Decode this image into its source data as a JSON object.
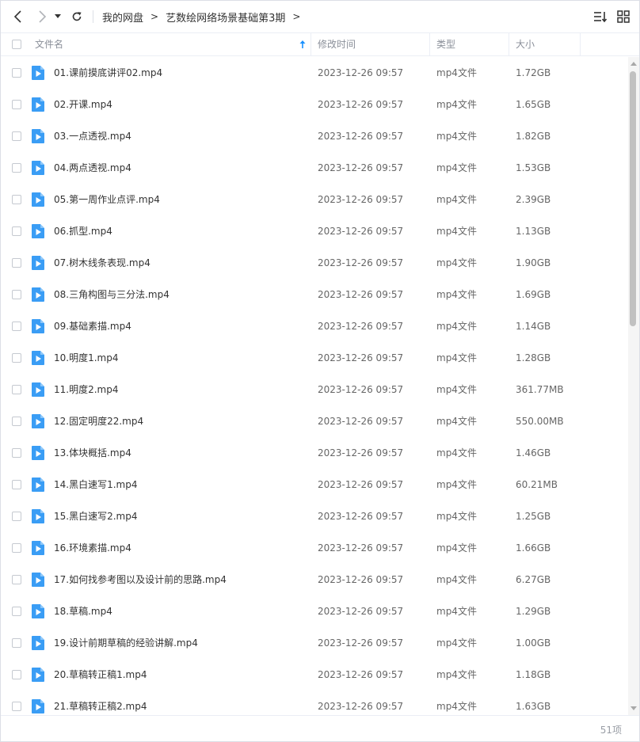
{
  "toolbar": {
    "back_icon": "chevron-left-icon",
    "forward_icon": "chevron-right-icon",
    "history_icon": "caret-down-icon",
    "refresh_icon": "refresh-icon",
    "breadcrumb": [
      {
        "label": "我的网盘"
      },
      {
        "label": "艺数绘网络场景基础第3期"
      }
    ],
    "breadcrumb_sep": ">",
    "sort_icon": "sort-list-icon",
    "view_icon": "grid-view-icon"
  },
  "table": {
    "columns": {
      "name": "文件名",
      "modified": "修改时间",
      "type": "类型",
      "size": "大小"
    },
    "sort_indicator": "arrow-up-icon",
    "rows": [
      {
        "name": "01.课前摸底讲评02.mp4",
        "modified": "2023-12-26 09:57",
        "type": "mp4文件",
        "size": "1.72GB"
      },
      {
        "name": "02.开课.mp4",
        "modified": "2023-12-26 09:57",
        "type": "mp4文件",
        "size": "1.65GB"
      },
      {
        "name": "03.一点透视.mp4",
        "modified": "2023-12-26 09:57",
        "type": "mp4文件",
        "size": "1.82GB"
      },
      {
        "name": "04.两点透视.mp4",
        "modified": "2023-12-26 09:57",
        "type": "mp4文件",
        "size": "1.53GB"
      },
      {
        "name": "05.第一周作业点评.mp4",
        "modified": "2023-12-26 09:57",
        "type": "mp4文件",
        "size": "2.39GB"
      },
      {
        "name": "06.抓型.mp4",
        "modified": "2023-12-26 09:57",
        "type": "mp4文件",
        "size": "1.13GB"
      },
      {
        "name": "07.树木线条表现.mp4",
        "modified": "2023-12-26 09:57",
        "type": "mp4文件",
        "size": "1.90GB"
      },
      {
        "name": "08.三角构图与三分法.mp4",
        "modified": "2023-12-26 09:57",
        "type": "mp4文件",
        "size": "1.69GB"
      },
      {
        "name": "09.基础素描.mp4",
        "modified": "2023-12-26 09:57",
        "type": "mp4文件",
        "size": "1.14GB"
      },
      {
        "name": "10.明度1.mp4",
        "modified": "2023-12-26 09:57",
        "type": "mp4文件",
        "size": "1.28GB"
      },
      {
        "name": "11.明度2.mp4",
        "modified": "2023-12-26 09:57",
        "type": "mp4文件",
        "size": "361.77MB"
      },
      {
        "name": "12.固定明度22.mp4",
        "modified": "2023-12-26 09:57",
        "type": "mp4文件",
        "size": "550.00MB"
      },
      {
        "name": "13.体块概括.mp4",
        "modified": "2023-12-26 09:57",
        "type": "mp4文件",
        "size": "1.46GB"
      },
      {
        "name": "14.黑白速写1.mp4",
        "modified": "2023-12-26 09:57",
        "type": "mp4文件",
        "size": "60.21MB"
      },
      {
        "name": "15.黑白速写2.mp4",
        "modified": "2023-12-26 09:57",
        "type": "mp4文件",
        "size": "1.25GB"
      },
      {
        "name": "16.环境素描.mp4",
        "modified": "2023-12-26 09:57",
        "type": "mp4文件",
        "size": "1.66GB"
      },
      {
        "name": "17.如何找参考图以及设计前的思路.mp4",
        "modified": "2023-12-26 09:57",
        "type": "mp4文件",
        "size": "6.27GB"
      },
      {
        "name": "18.草稿.mp4",
        "modified": "2023-12-26 09:57",
        "type": "mp4文件",
        "size": "1.29GB"
      },
      {
        "name": "19.设计前期草稿的经验讲解.mp4",
        "modified": "2023-12-26 09:57",
        "type": "mp4文件",
        "size": "1.00GB"
      },
      {
        "name": "20.草稿转正稿1.mp4",
        "modified": "2023-12-26 09:57",
        "type": "mp4文件",
        "size": "1.18GB"
      },
      {
        "name": "21.草稿转正稿2.mp4",
        "modified": "2023-12-26 09:57",
        "type": "mp4文件",
        "size": "1.63GB"
      }
    ],
    "file_icon": "video-file-icon"
  },
  "footer": {
    "item_count": "51项"
  },
  "colors": {
    "accent": "#1890ff",
    "file_icon": "#3a9df5",
    "border": "#ebeef5"
  }
}
